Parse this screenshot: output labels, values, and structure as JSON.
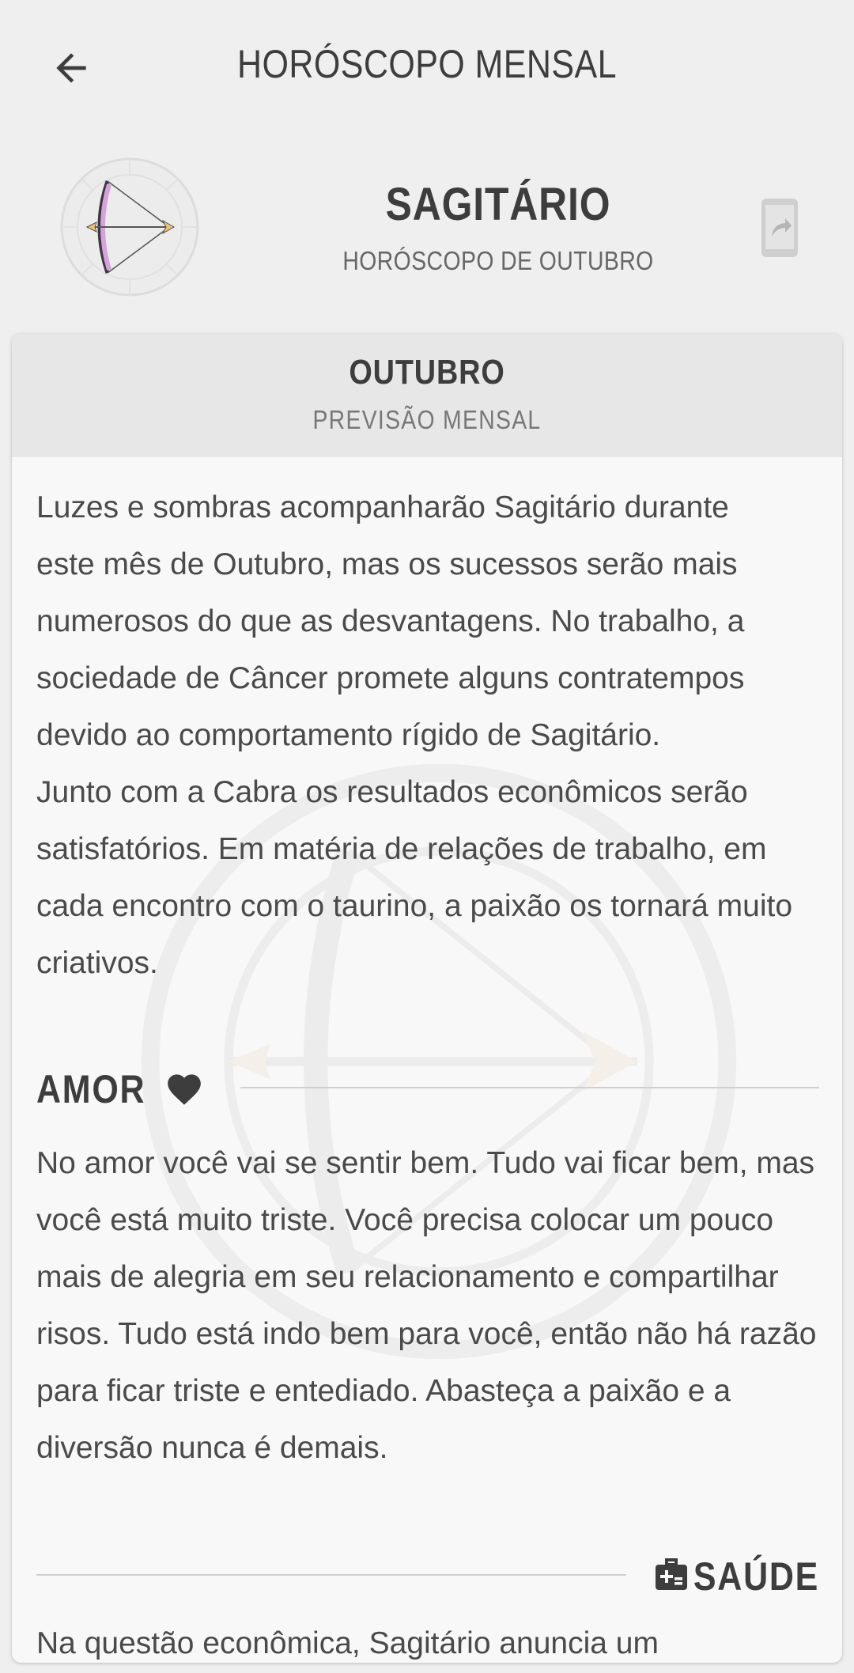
{
  "topbar": {
    "title": "HORÓSCOPO MENSAL",
    "back_icon": "arrow-left-icon"
  },
  "sign": {
    "name": "SAGITÁRIO",
    "subtitle": "HORÓSCOPO DE OUTUBRO",
    "emblem_icon": "sagittarius-bow-icon",
    "share_icon": "share-phone-icon"
  },
  "card": {
    "month": "OUTUBRO",
    "forecast_label": "PREVISÃO MENSAL",
    "main_lines": [
      "Luzes e sombras acompanharão Sagitário durante",
      "este mês de Outubro, mas os sucessos serão mais",
      "numerosos do que as desvantagens. No trabalho, a",
      "sociedade de Câncer promete alguns contratempos",
      "devido ao comportamento rígido de Sagitário.",
      "Junto com a Cabra os resultados econômicos serão",
      "satisfatórios. Em matéria de relações de trabalho, em",
      "cada encontro com o taurino, a paixão os tornará muito",
      "criativos."
    ],
    "love": {
      "title": "AMOR",
      "icon": "heart-icon",
      "lines": [
        "No amor você vai se sentir bem. Tudo vai ficar bem, mas",
        "você está muito triste. Você precisa colocar um pouco",
        "mais de alegria em seu relacionamento e compartilhar",
        "risos. Tudo está indo bem para você, então não há razão",
        "para ficar triste e entediado. Abasteça a paixão e a",
        "diversão nunca é demais."
      ]
    },
    "health": {
      "title": "SAÚDE",
      "icon": "medical-kit-icon",
      "lines": [
        "Na questão econômica, Sagitário anuncia um"
      ]
    }
  },
  "colors": {
    "background": "#efefef",
    "card": "#f8f8f8",
    "card_header": "#e7e7e7",
    "text": "#444444",
    "emblem_accent": "#c77fd0"
  }
}
